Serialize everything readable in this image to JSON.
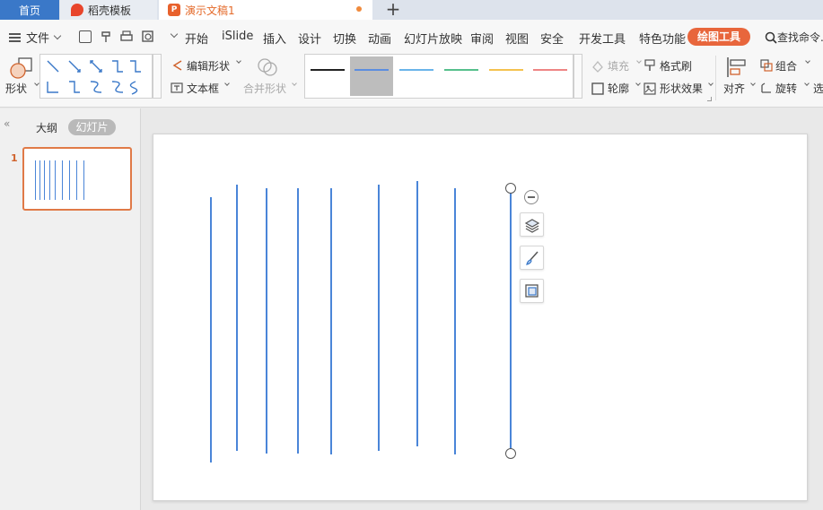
{
  "tabs": {
    "home": "首页",
    "template": "稻壳模板",
    "document": "演示文稿1",
    "add": "+"
  },
  "menu": {
    "file": "文件",
    "items": [
      "开始",
      "iSlide",
      "插入",
      "设计",
      "切换",
      "动画",
      "幻灯片放映",
      "审阅",
      "视图",
      "安全",
      "开发工具",
      "特色功能"
    ],
    "active": "绘图工具",
    "search": "查找命令..."
  },
  "ribbon": {
    "shape": "形状",
    "edit_shape": "编辑形状",
    "text_box": "文本框",
    "merge_shape": "合并形状",
    "fill": "填充",
    "format_painter": "格式刷",
    "outline": "轮廓",
    "shape_effect": "形状效果",
    "align": "对齐",
    "group": "组合",
    "rotate": "旋转",
    "select": "选"
  },
  "style_colors": [
    "#222222",
    "#5b8ee0",
    "#6ab4ea",
    "#56c08c",
    "#f4c24f",
    "#ee8584"
  ],
  "left_panel": {
    "outline_tab": "大纲",
    "slides_tab": "幻灯片",
    "slide_number": "1"
  },
  "colors": {
    "accent": "#e8663c",
    "line": "#4a85d8",
    "home_tab": "#3a78c8"
  }
}
